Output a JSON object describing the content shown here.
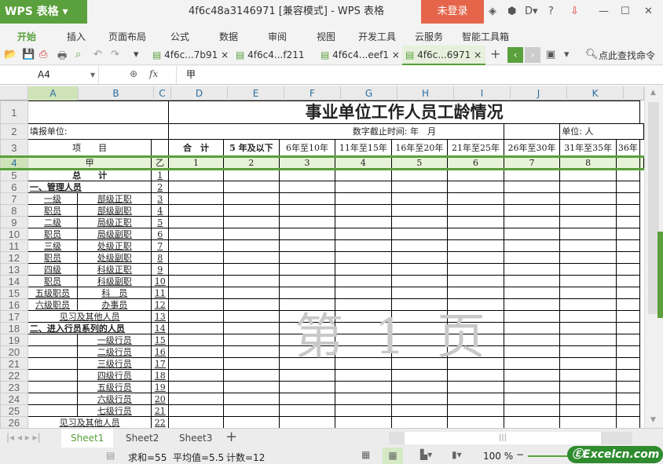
{
  "app": {
    "name": "WPS 表格",
    "window_title": "4f6c48a3146971 [兼容模式] - WPS 表格",
    "login": "未登录",
    "help": "?"
  },
  "menu": [
    "开始",
    "插入",
    "页面布局",
    "公式",
    "数据",
    "审阅",
    "视图",
    "开发工具",
    "云服务",
    "智能工具箱"
  ],
  "doc_tabs": [
    {
      "label": "4f6c...7b91"
    },
    {
      "label": "4f6c4...f211"
    },
    {
      "label": "4f6c4...eef1"
    },
    {
      "label": "4f6c...6971",
      "active": true
    }
  ],
  "search_command": "点此查找命令",
  "formula_bar": {
    "cell_ref": "A4",
    "fx": "fx",
    "value": "甲"
  },
  "columns": [
    "A",
    "B",
    "C",
    "D",
    "E",
    "F",
    "G",
    "H",
    "I",
    "J",
    "K"
  ],
  "sheet": {
    "title": "事业单位工作人员工龄情况",
    "fill_unit": "填报单位:",
    "deadline": "数字截止时间: 年　月",
    "unit": "单位: 人",
    "header": [
      "项　　目",
      "",
      "合　计",
      "5 年及以下",
      "6年至10年",
      "11年至15年",
      "16年至20年",
      "21年至25年",
      "26年至30年",
      "31年至35年",
      "36年"
    ],
    "row4": [
      "甲",
      "乙",
      "1",
      "2",
      "3",
      "4",
      "5",
      "6",
      "7",
      "8"
    ],
    "rows": [
      {
        "a": "总　　计",
        "b": "",
        "n": "1",
        "style": "total"
      },
      {
        "a": "一、管理人员",
        "b": "",
        "n": "2",
        "style": "section"
      },
      {
        "a": "一级",
        "b": "部级正职",
        "n": "3"
      },
      {
        "a": "职员",
        "b": "部级副职",
        "n": "4"
      },
      {
        "a": "二级",
        "b": "局级正职",
        "n": "5"
      },
      {
        "a": "职员",
        "b": "局级副职",
        "n": "6"
      },
      {
        "a": "三级",
        "b": "处级正职",
        "n": "7"
      },
      {
        "a": "职员",
        "b": "处级副职",
        "n": "8"
      },
      {
        "a": "四级",
        "b": "科级正职",
        "n": "9"
      },
      {
        "a": "职员",
        "b": "科级副职",
        "n": "10"
      },
      {
        "a": "五级职员",
        "b": "科　员",
        "n": "11"
      },
      {
        "a": "六级职员",
        "b": "办事员",
        "n": "12"
      },
      {
        "a": "见习及其他人员",
        "b": "",
        "n": "13",
        "style": "merged"
      },
      {
        "a": "二、进入行员系列的人员",
        "b": "",
        "n": "14",
        "style": "section"
      },
      {
        "a": "",
        "b": "一级行员",
        "n": "15"
      },
      {
        "a": "",
        "b": "二级行员",
        "n": "16"
      },
      {
        "a": "",
        "b": "三级行员",
        "n": "17"
      },
      {
        "a": "",
        "b": "四级行员",
        "n": "18"
      },
      {
        "a": "",
        "b": "五级行员",
        "n": "19"
      },
      {
        "a": "",
        "b": "六级行员",
        "n": "20"
      },
      {
        "a": "",
        "b": "七级行员",
        "n": "21"
      },
      {
        "a": "见习及其他人员",
        "b": "",
        "n": "22",
        "style": "merged"
      }
    ]
  },
  "watermark": "第 1 页",
  "sheet_tabs": [
    "Sheet1",
    "Sheet2",
    "Sheet3"
  ],
  "status": {
    "sum": "求和=55",
    "avg": "平均值=5.5",
    "count": "计数=12",
    "zoom": "100 %"
  },
  "brand": "Excelcn.com",
  "colors": {
    "accent": "#5aa03c",
    "login": "#e4654a"
  }
}
